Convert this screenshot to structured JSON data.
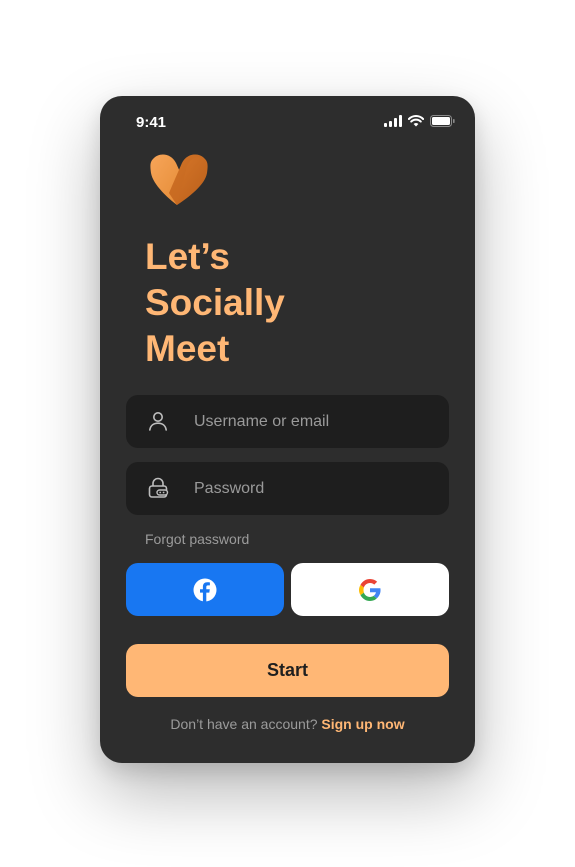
{
  "status_bar": {
    "time": "9:41",
    "icons": [
      "signal-icon",
      "wifi-icon",
      "battery-icon"
    ]
  },
  "brand": {
    "logo_icon": "heart-v-logo",
    "headline": [
      "Let’s",
      "Socially",
      "Meet"
    ]
  },
  "form": {
    "username": {
      "value": "",
      "placeholder": "Username or email",
      "icon": "user-icon"
    },
    "password": {
      "value": "",
      "placeholder": "Password",
      "icon": "lock-icon"
    },
    "forgot_label": "Forgot password"
  },
  "social": {
    "facebook_icon": "facebook-icon",
    "google_icon": "google-icon"
  },
  "start_label": "Start",
  "footer": {
    "prompt": "Don’t have an account?",
    "signup_label": "Sign up now"
  },
  "colors": {
    "accent": "#ffb775",
    "background": "#2d2d2d",
    "field": "#1e1e1e",
    "facebook": "#1877f2",
    "muted_text": "#9b9b9b"
  }
}
